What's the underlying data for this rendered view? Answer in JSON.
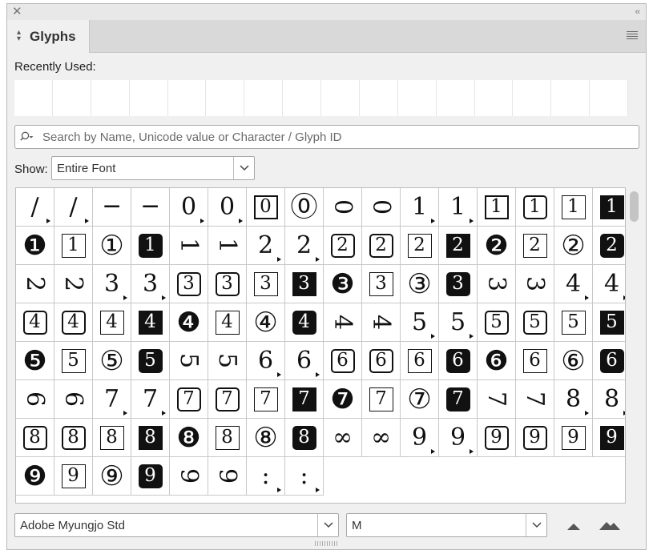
{
  "panel": {
    "title": "Glyphs",
    "close_icon": "close-icon",
    "collapse_icon": "double-chevron-left-icon",
    "menu_icon": "panel-menu-icon"
  },
  "recent": {
    "label": "Recently Used:",
    "slots": 16
  },
  "search": {
    "placeholder": "Search by Name, Unicode value or Character / Glyph ID",
    "value": ""
  },
  "show": {
    "label": "Show:",
    "value": "Entire Font"
  },
  "font": {
    "family": "Adobe Myungjo Std",
    "style": "M"
  },
  "glyphs": [
    {
      "c": "/",
      "k": "plain",
      "a": 1
    },
    {
      "c": "/",
      "k": "plain",
      "a": 1
    },
    {
      "c": "─",
      "k": "plain",
      "a": 0
    },
    {
      "c": "─",
      "k": "plain",
      "a": 0
    },
    {
      "c": "0",
      "k": "plain",
      "a": 1
    },
    {
      "c": "0",
      "k": "plain",
      "a": 1
    },
    {
      "c": "0",
      "k": "sq"
    },
    {
      "c": "⓪",
      "k": "circ"
    },
    {
      "c": "0",
      "k": "rot"
    },
    {
      "c": "0",
      "k": "rot"
    },
    {
      "c": "1",
      "k": "plain",
      "a": 1
    },
    {
      "c": "1",
      "k": "plain",
      "a": 1
    },
    {
      "c": "1",
      "k": "sq"
    },
    {
      "c": "1",
      "k": "sqr"
    },
    {
      "c": "1",
      "k": "sqt"
    },
    {
      "c": "1",
      "k": "solid"
    },
    {
      "c": "❶",
      "k": "circ"
    },
    {
      "c": "1",
      "k": "sqt"
    },
    {
      "c": "①",
      "k": "circ"
    },
    {
      "c": "1",
      "k": "solidr"
    },
    {
      "c": "1",
      "k": "rot"
    },
    {
      "c": "1",
      "k": "rot"
    },
    {
      "c": "2",
      "k": "plain",
      "a": 1
    },
    {
      "c": "2",
      "k": "plain",
      "a": 1
    },
    {
      "c": "2",
      "k": "sqr"
    },
    {
      "c": "2",
      "k": "sqr"
    },
    {
      "c": "2",
      "k": "sqt"
    },
    {
      "c": "2",
      "k": "solid"
    },
    {
      "c": "❷",
      "k": "circ"
    },
    {
      "c": "2",
      "k": "sqt"
    },
    {
      "c": "②",
      "k": "circ"
    },
    {
      "c": "2",
      "k": "solidr"
    },
    {
      "c": "2",
      "k": "rot"
    },
    {
      "c": "2",
      "k": "rot"
    },
    {
      "c": "3",
      "k": "plain",
      "a": 1
    },
    {
      "c": "3",
      "k": "plain",
      "a": 1
    },
    {
      "c": "3",
      "k": "sqr"
    },
    {
      "c": "3",
      "k": "sqr"
    },
    {
      "c": "3",
      "k": "sqt"
    },
    {
      "c": "3",
      "k": "solid"
    },
    {
      "c": "❸",
      "k": "circ"
    },
    {
      "c": "3",
      "k": "sqt"
    },
    {
      "c": "③",
      "k": "circ"
    },
    {
      "c": "3",
      "k": "solidr"
    },
    {
      "c": "3",
      "k": "rot"
    },
    {
      "c": "3",
      "k": "rot"
    },
    {
      "c": "4",
      "k": "plain",
      "a": 1
    },
    {
      "c": "4",
      "k": "plain",
      "a": 1
    },
    {
      "c": "4",
      "k": "sqr"
    },
    {
      "c": "4",
      "k": "sqr"
    },
    {
      "c": "4",
      "k": "sqt"
    },
    {
      "c": "4",
      "k": "solid"
    },
    {
      "c": "❹",
      "k": "circ"
    },
    {
      "c": "4",
      "k": "sqt"
    },
    {
      "c": "④",
      "k": "circ"
    },
    {
      "c": "4",
      "k": "solidr"
    },
    {
      "c": "4",
      "k": "rot"
    },
    {
      "c": "4",
      "k": "rot"
    },
    {
      "c": "5",
      "k": "plain",
      "a": 1
    },
    {
      "c": "5",
      "k": "plain",
      "a": 1
    },
    {
      "c": "5",
      "k": "sqr"
    },
    {
      "c": "5",
      "k": "sqr"
    },
    {
      "c": "5",
      "k": "sqt"
    },
    {
      "c": "5",
      "k": "solid"
    },
    {
      "c": "❺",
      "k": "circ"
    },
    {
      "c": "5",
      "k": "sqt"
    },
    {
      "c": "⑤",
      "k": "circ"
    },
    {
      "c": "5",
      "k": "solidr"
    },
    {
      "c": "5",
      "k": "rot"
    },
    {
      "c": "5",
      "k": "rot"
    },
    {
      "c": "6",
      "k": "plain",
      "a": 1
    },
    {
      "c": "6",
      "k": "plain",
      "a": 1
    },
    {
      "c": "6",
      "k": "sqr"
    },
    {
      "c": "6",
      "k": "sqr"
    },
    {
      "c": "6",
      "k": "sqt"
    },
    {
      "c": "6",
      "k": "solidr"
    },
    {
      "c": "❻",
      "k": "circ"
    },
    {
      "c": "6",
      "k": "sqt"
    },
    {
      "c": "⑥",
      "k": "circ"
    },
    {
      "c": "6",
      "k": "solidr"
    },
    {
      "c": "6",
      "k": "rot"
    },
    {
      "c": "6",
      "k": "rot"
    },
    {
      "c": "7",
      "k": "plain",
      "a": 1
    },
    {
      "c": "7",
      "k": "plain",
      "a": 1
    },
    {
      "c": "7",
      "k": "sqr"
    },
    {
      "c": "7",
      "k": "sqr"
    },
    {
      "c": "7",
      "k": "sqt"
    },
    {
      "c": "7",
      "k": "solid"
    },
    {
      "c": "❼",
      "k": "circ"
    },
    {
      "c": "7",
      "k": "sqt"
    },
    {
      "c": "⑦",
      "k": "circ"
    },
    {
      "c": "7",
      "k": "solidr"
    },
    {
      "c": "7",
      "k": "rot"
    },
    {
      "c": "7",
      "k": "rot"
    },
    {
      "c": "8",
      "k": "plain",
      "a": 1
    },
    {
      "c": "8",
      "k": "plain",
      "a": 1
    },
    {
      "c": "8",
      "k": "sqr"
    },
    {
      "c": "8",
      "k": "sqr"
    },
    {
      "c": "8",
      "k": "sqt"
    },
    {
      "c": "8",
      "k": "solid"
    },
    {
      "c": "❽",
      "k": "circ"
    },
    {
      "c": "8",
      "k": "sqt"
    },
    {
      "c": "⑧",
      "k": "circ"
    },
    {
      "c": "8",
      "k": "solidr"
    },
    {
      "c": "∞",
      "k": "plain",
      "a": 0
    },
    {
      "c": "∞",
      "k": "plain",
      "a": 0
    },
    {
      "c": "9",
      "k": "plain",
      "a": 1
    },
    {
      "c": "9",
      "k": "plain",
      "a": 1
    },
    {
      "c": "9",
      "k": "sqr"
    },
    {
      "c": "9",
      "k": "sqr"
    },
    {
      "c": "9",
      "k": "sqt"
    },
    {
      "c": "9",
      "k": "solid"
    },
    {
      "c": "❾",
      "k": "circ"
    },
    {
      "c": "9",
      "k": "sqt"
    },
    {
      "c": "⑨",
      "k": "circ"
    },
    {
      "c": "9",
      "k": "solidr"
    },
    {
      "c": "9",
      "k": "rot"
    },
    {
      "c": "9",
      "k": "rot"
    },
    {
      "c": ":",
      "k": "plain",
      "a": 1
    },
    {
      "c": ":",
      "k": "plain",
      "a": 1
    }
  ],
  "footer": {
    "zoom_out_icon": "small-mountain-icon",
    "zoom_in_icon": "large-mountain-icon"
  }
}
